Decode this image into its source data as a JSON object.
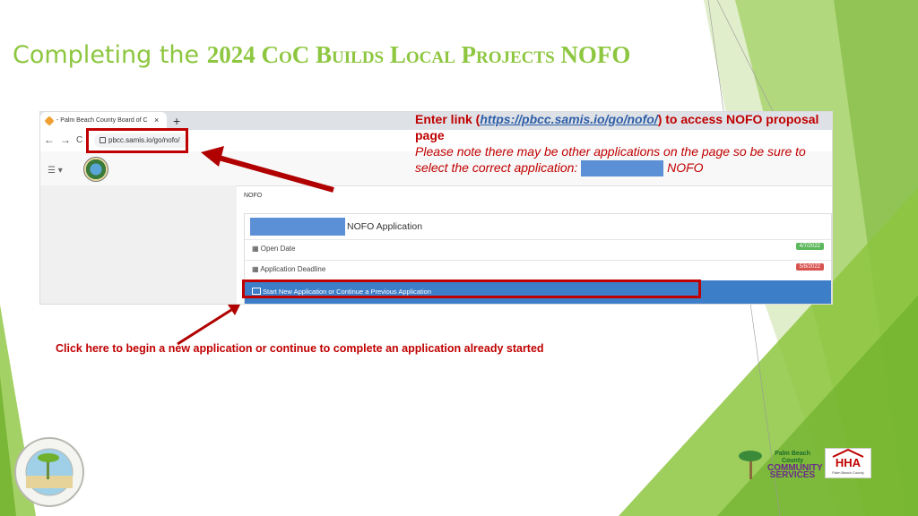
{
  "slide": {
    "title_lead": "Completing the ",
    "title_rest": "2024 CoC Builds Local Projects NOFO"
  },
  "browser": {
    "tab_title": "- Palm Beach County Board of C",
    "tab_close": "×",
    "new_tab": "+",
    "back": "←",
    "forward": "→",
    "reload": "C",
    "url": "pbcc.samis.io/go/nofo/"
  },
  "app": {
    "breadcrumb": "NOFO",
    "application_title": "NOFO Application",
    "open_date_label": "Open Date",
    "open_date_value": "4/7/2022",
    "deadline_label": "Application Deadline",
    "deadline_value": "5/8/2022",
    "start_label": "Start New Application or Continue a Previous Application"
  },
  "callout": {
    "line1_prefix": "Enter link (",
    "link": "https://pbcc.samis.io/go/nofo/",
    "line1_suffix": ") to access NOFO proposal page",
    "note": "Please note there may be other applications on the page so be sure to select the correct application: ",
    "note_suffix": " NOFO"
  },
  "instruction": "Click here to begin a new application or continue to complete an application already started",
  "logos": {
    "pbc_line1": "Palm Beach County",
    "pbc_line2": "COMMUNITY",
    "pbc_line3": "SERVICES",
    "hha": "HHA",
    "hha_sub": "Palm Beach County"
  },
  "colors": {
    "title_green": "#8dc63f",
    "highlight_red": "#c00000",
    "link_blue": "#2e5fa8",
    "button_blue": "#3d7ec9",
    "open_badge": "#5cb85c",
    "deadline_badge": "#d9534f"
  }
}
